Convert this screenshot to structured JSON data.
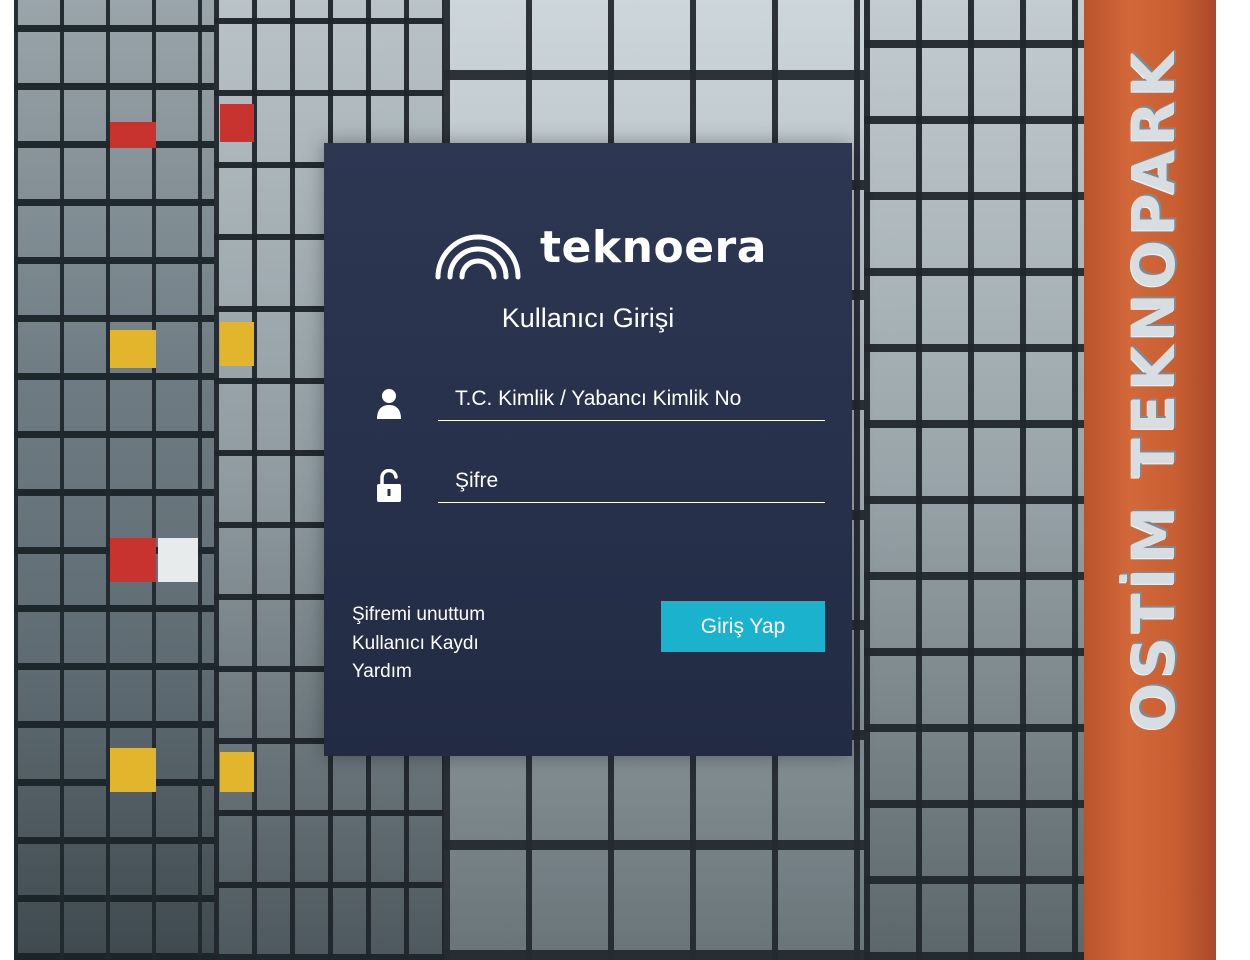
{
  "background": {
    "building_sign": "OSTİM TEKNOPARK"
  },
  "brand": {
    "logo_text": "teknoera",
    "logo_icon": "arc-logo-icon"
  },
  "login": {
    "heading": "Kullanıcı Girişi",
    "id_placeholder": "T.C. Kimlik / Yabancı Kimlik No",
    "id_value": "",
    "id_icon": "user-icon",
    "password_placeholder": "Şifre",
    "password_value": "",
    "password_icon": "unlock-icon",
    "submit_label": "Giriş Yap"
  },
  "links": {
    "forgot_password": "Şifremi unuttum",
    "register": "Kullanıcı Kaydı",
    "help": "Yardım"
  },
  "colors": {
    "panel": "#26304a",
    "button": "#1ab2cd",
    "text": "#ffffff",
    "wall": "#c85e31"
  }
}
